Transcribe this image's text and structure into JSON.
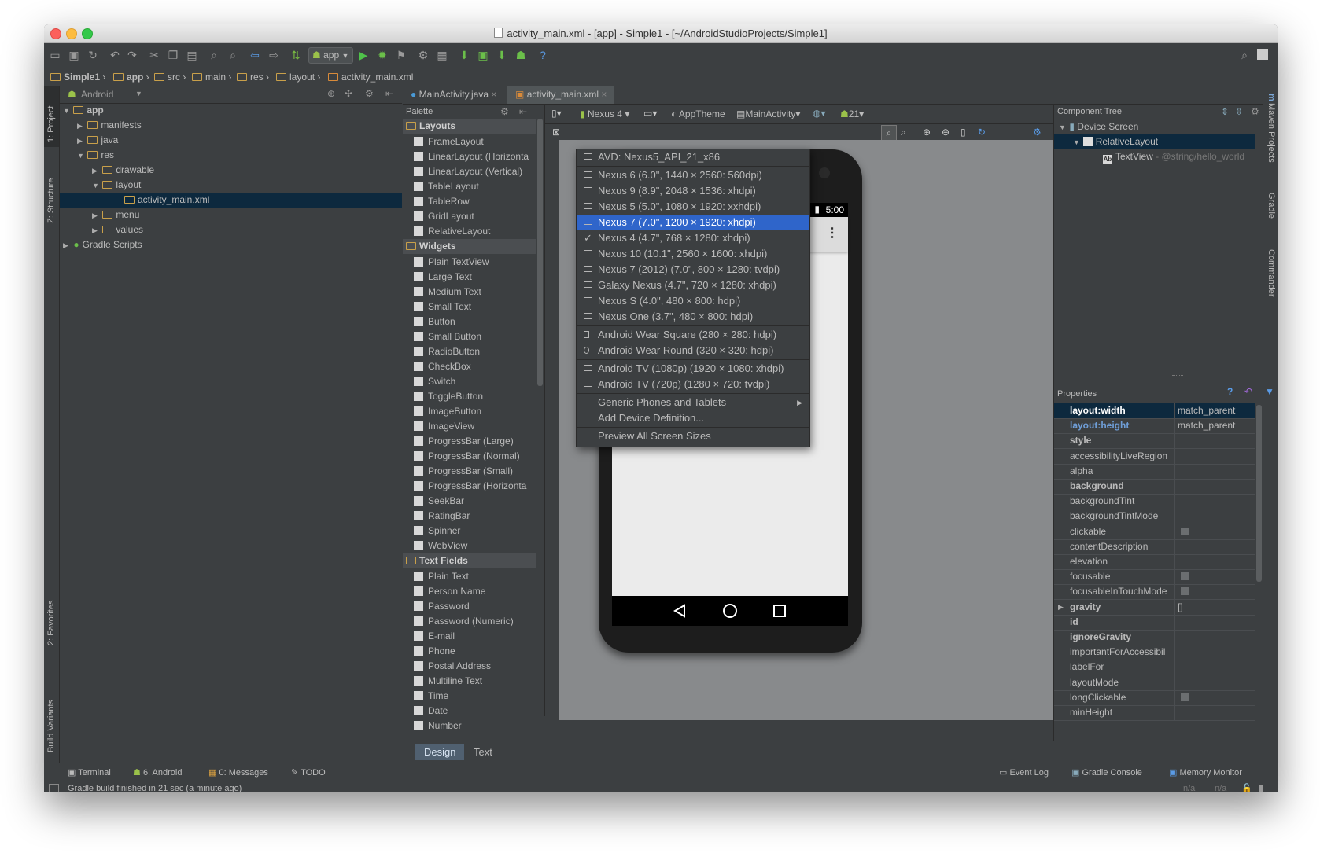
{
  "window": {
    "title": "activity_main.xml - [app] - Simple1 - [~/AndroidStudioProjects/Simple1]"
  },
  "toolbar": {
    "run_config": "app"
  },
  "breadcrumbs": [
    "Simple1",
    "app",
    "src",
    "main",
    "res",
    "layout",
    "activity_main.xml"
  ],
  "left_strip": {
    "project": "1: Project",
    "structure": "Z: Structure",
    "favorites": "2: Favorites",
    "build_variants": "Build Variants"
  },
  "right_strip": {
    "maven": "Maven Projects",
    "gradle": "Gradle",
    "commander": "Commander"
  },
  "project_panel": {
    "view_selector": "Android",
    "tree": [
      "app",
      "manifests",
      "java",
      "res",
      "drawable",
      "layout",
      "activity_main.xml",
      "menu",
      "values",
      "Gradle Scripts"
    ]
  },
  "editor_tabs": [
    "MainActivity.java",
    "activity_main.xml"
  ],
  "palette": {
    "title": "Palette",
    "sections": [
      {
        "name": "Layouts",
        "items": [
          "FrameLayout",
          "LinearLayout (Horizonta",
          "LinearLayout (Vertical)",
          "TableLayout",
          "TableRow",
          "GridLayout",
          "RelativeLayout"
        ]
      },
      {
        "name": "Widgets",
        "items": [
          "Plain TextView",
          "Large Text",
          "Medium Text",
          "Small Text",
          "Button",
          "Small Button",
          "RadioButton",
          "CheckBox",
          "Switch",
          "ToggleButton",
          "ImageButton",
          "ImageView",
          "ProgressBar (Large)",
          "ProgressBar (Normal)",
          "ProgressBar (Small)",
          "ProgressBar (Horizonta",
          "SeekBar",
          "RatingBar",
          "Spinner",
          "WebView"
        ]
      },
      {
        "name": "Text Fields",
        "items": [
          "Plain Text",
          "Person Name",
          "Password",
          "Password (Numeric)",
          "E-mail",
          "Phone",
          "Postal Address",
          "Multiline Text",
          "Time",
          "Date",
          "Number"
        ]
      }
    ]
  },
  "designer_toolbar": {
    "device": "Nexus 4",
    "theme": "AppTheme",
    "activity": "MainActivity",
    "api": "21"
  },
  "phone": {
    "status_time": "5:00"
  },
  "device_menu": {
    "items": [
      "AVD: Nexus5_API_21_x86",
      "Nexus 6 (6.0\", 1440 × 2560: 560dpi)",
      "Nexus 9 (8.9\", 2048 × 1536: xhdpi)",
      "Nexus 5 (5.0\", 1080 × 1920: xxhdpi)",
      "Nexus 7 (7.0\", 1200 × 1920: xhdpi)",
      "Nexus 4 (4.7\", 768 × 1280: xhdpi)",
      "Nexus 10 (10.1\", 2560 × 1600: xhdpi)",
      "Nexus 7 (2012) (7.0\", 800 × 1280: tvdpi)",
      "Galaxy Nexus (4.7\", 720 × 1280: xhdpi)",
      "Nexus S (4.0\", 480 × 800: hdpi)",
      "Nexus One (3.7\", 480 × 800: hdpi)",
      "Android Wear Square (280 × 280: hdpi)",
      "Android Wear Round (320 × 320: hdpi)",
      "Android TV (1080p) (1920 × 1080: xhdpi)",
      "Android TV (720p) (1280 × 720: tvdpi)",
      "Generic Phones and Tablets",
      "Add Device Definition...",
      "Preview All Screen Sizes"
    ],
    "selected": "Nexus 7 (7.0\", 1200 × 1920: xhdpi)",
    "checked": "Nexus 4 (4.7\", 768 × 1280: xhdpi)"
  },
  "design_tabs": {
    "design": "Design",
    "text": "Text"
  },
  "component_tree": {
    "title": "Component Tree",
    "device_screen": "Device Screen",
    "relative_layout": "RelativeLayout",
    "textview": "TextView",
    "textview_value": "- @string/hello_world"
  },
  "properties": {
    "title": "Properties",
    "rows": [
      {
        "name": "layout:width",
        "value": "match_parent"
      },
      {
        "name": "layout:height",
        "value": "match_parent"
      },
      {
        "name": "style",
        "value": ""
      },
      {
        "name": "accessibilityLiveRegion",
        "value": ""
      },
      {
        "name": "alpha",
        "value": ""
      },
      {
        "name": "background",
        "value": ""
      },
      {
        "name": "backgroundTint",
        "value": ""
      },
      {
        "name": "backgroundTintMode",
        "value": ""
      },
      {
        "name": "clickable",
        "value": ""
      },
      {
        "name": "contentDescription",
        "value": ""
      },
      {
        "name": "elevation",
        "value": ""
      },
      {
        "name": "focusable",
        "value": ""
      },
      {
        "name": "focusableInTouchMode",
        "value": ""
      },
      {
        "name": "gravity",
        "value": "[]"
      },
      {
        "name": "id",
        "value": ""
      },
      {
        "name": "ignoreGravity",
        "value": ""
      },
      {
        "name": "importantForAccessibil",
        "value": ""
      },
      {
        "name": "labelFor",
        "value": ""
      },
      {
        "name": "layoutMode",
        "value": ""
      },
      {
        "name": "longClickable",
        "value": ""
      },
      {
        "name": "minHeight",
        "value": ""
      }
    ]
  },
  "bottom_tools": {
    "terminal": "Terminal",
    "android": "6: Android",
    "messages": "0: Messages",
    "todo": "TODO",
    "event_log": "Event Log",
    "gradle_console": "Gradle Console",
    "memory_monitor": "Memory Monitor"
  },
  "status": {
    "message": "Gradle build finished in 21 sec (a minute ago)",
    "na1": "n/a",
    "na2": "n/a"
  },
  "colors": {
    "accent": "#2f65ca",
    "panel": "#3c3f41",
    "folder": "#c9a04a"
  }
}
